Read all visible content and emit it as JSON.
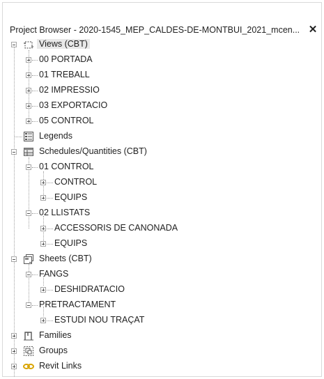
{
  "panel": {
    "title": "Project Browser - 2020-1545_MEP_CALDES-DE-MONTBUI_2021_mcen...",
    "close_glyph": "✕"
  },
  "tree": {
    "views": {
      "label": "Views (CBT)",
      "icon": "views-icon",
      "children": [
        "00 PORTADA",
        "01 TREBALL",
        "02 IMPRESSIO",
        "03 EXPORTACIO",
        "05 CONTROL"
      ]
    },
    "legends": {
      "label": "Legends",
      "icon": "legends-icon"
    },
    "schedules": {
      "label": "Schedules/Quantities (CBT)",
      "icon": "schedules-icon",
      "groups": [
        {
          "label": "01 CONTROL",
          "children": [
            "CONTROL",
            "EQUIPS"
          ]
        },
        {
          "label": "02 LLISTATS",
          "children": [
            "ACCESSORIS DE CANONADA",
            "EQUIPS"
          ]
        }
      ]
    },
    "sheets": {
      "label": "Sheets (CBT)",
      "icon": "sheets-icon",
      "groups": [
        {
          "label": "FANGS",
          "children": [
            "DESHIDRATACIO"
          ]
        },
        {
          "label": "PRETRACTAMENT",
          "children": [
            "ESTUDI NOU TRAÇAT"
          ]
        }
      ]
    },
    "families": {
      "label": "Families",
      "icon": "families-icon"
    },
    "groups": {
      "label": "Groups",
      "icon": "groups-icon"
    },
    "revit_links": {
      "label": "Revit Links",
      "icon": "revit-links-icon"
    }
  },
  "colors": {
    "selection": "#e8e8e8",
    "link_icon": "#d9a400"
  }
}
